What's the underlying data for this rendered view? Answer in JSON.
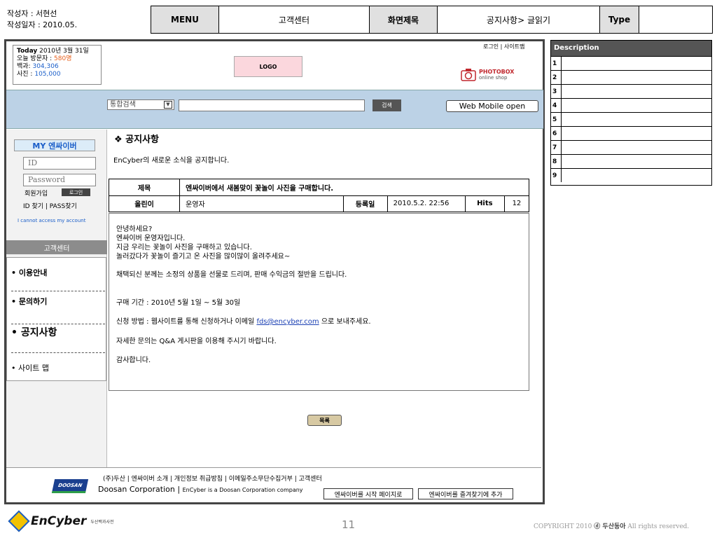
{
  "meta": {
    "author_label": "작성자 : 서현선",
    "date_label": "작성일자 : 2010.05."
  },
  "header": {
    "menu_label": "MENU",
    "menu_value": "고객센터",
    "screen_label": "화면제목",
    "screen_value": "공지사항> 글읽기",
    "type_label": "Type",
    "type_value": ""
  },
  "today": {
    "label": "Today",
    "date": "2010년 3월 31일",
    "visitors_label": "오늘 방문자 :",
    "visitors": "580명",
    "encyclopedia_label": "백과:",
    "encyclopedia": "304,306",
    "photo_label": "사진 :",
    "photo": "105,000"
  },
  "logo": "LOGO",
  "top_links": "로그인 | 사이트맵",
  "photobox": {
    "title": "PHOTOBOX",
    "sub": "online shop"
  },
  "search": {
    "select_value": "통합검색",
    "button": "검색",
    "mobile_button": "Web Mobile open"
  },
  "sidebar": {
    "my_title": "MY 엔싸이버",
    "id_placeholder": "ID",
    "password_placeholder": "Password",
    "join": "회원가입",
    "login": "로그인",
    "find": "ID 찾기 |  PASS찾기",
    "cannot": "I cannot access my account",
    "cs_head": "고객센터",
    "menu": [
      "• 이용안내",
      "•  문의하기",
      "• 공지사항",
      "• 사이트 맵"
    ]
  },
  "content": {
    "title": "❖ 공지사항",
    "desc": "EnCyber의 새로운 소식을 공지합니다.",
    "subject_label": "제목",
    "subject": "엔싸이버에서 새봄맞이 꽃놀이 사진을 구매합니다.",
    "author_label": "올린이",
    "author": "운영자",
    "date_label": "등록일",
    "date": "2010.5.2. 22:56",
    "hits_label": "Hits",
    "hits": "12",
    "body": [
      "안녕하세요?",
      "엔싸이버 운영자입니다.",
      "지금 우리는 꽃놀이 사진을 구매하고 있습니다.",
      "놀러갔다가 꽃놀이 즐기고 온 사진을 많이많이 올려주세요~",
      "채택되신 분께는 소정의 상품을 선물로 드리며, 판매 수익금의 절반을 드립니다.",
      "구매 기간 : 2010년 5월 1일 ~ 5월 30일",
      "신청 방법 : 웹사이트를 통해 신청하거나 이메일",
      "fds@encyber.com",
      "으로 보내주세요.",
      "자세한 문의는 Q&A 게시판을 이용해 주시기 바랍니다.",
      "감사합니다."
    ],
    "list_button": "목록"
  },
  "footer": {
    "doosan_logo": "DOOSAN",
    "links": "(주)두산   |  엔싸이버 소개   |   개인정보 취급방침   |   이메일주소무단수집거부   |   고객센터",
    "corp": "Doosan Corporation  |  ",
    "corp_small": "EnCyber is a Doosan Corporation company",
    "start_page_btn": "엔싸이버를 시작 페이지로",
    "favorite_btn": "엔싸이버를 즐겨찾기에 추가"
  },
  "description": {
    "title": "Description",
    "rows": [
      "1",
      "2",
      "3",
      "4",
      "5",
      "6",
      "7",
      "8",
      "9"
    ]
  },
  "bottom": {
    "brand": "EnCyber",
    "brand_sub": "두산백과사전",
    "page": "11",
    "copyright": "COPYRIGHT 2010",
    "copyright_company": "ⓓ 두산동아",
    "copyright_tail": "All rights reserved."
  }
}
